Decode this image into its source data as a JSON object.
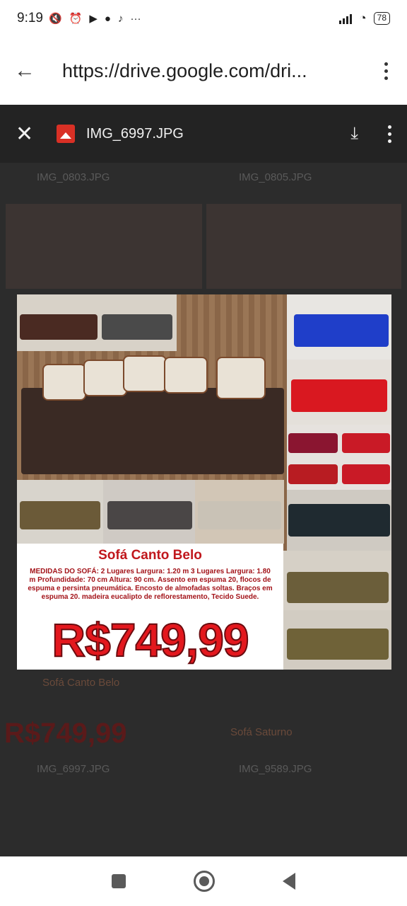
{
  "status": {
    "time": "9:19",
    "battery": "78"
  },
  "browser": {
    "url": "https://drive.google.com/dri..."
  },
  "viewer": {
    "file_name": "IMG_6997.JPG",
    "background_files": [
      "IMG_0803.JPG",
      "IMG_0805.JPG",
      "IMG_6997.JPG",
      "IMG_9589.JPG"
    ],
    "background_texts": [
      "Sofá Canto Belo",
      "R$749,99",
      "Sofá Saturno"
    ]
  },
  "ad": {
    "title": "Sofá Canto Belo",
    "description": "MEDIDAS DO SOFÁ: 2 Lugares Largura: 1.20 m 3 Lugares Largura: 1.80 m Profundidade: 70 cm Altura: 90 cm. Assento em espuma 20, flocos de espuma e persinta pneumática. Encosto de almofadas soltas. Braços em espuma 20. madeira eucalipto de reflorestamento, Tecido Suede.",
    "price": "R$749,99"
  },
  "colors": {
    "accent_red": "#e3181e",
    "drive_icon": "#d93025"
  }
}
